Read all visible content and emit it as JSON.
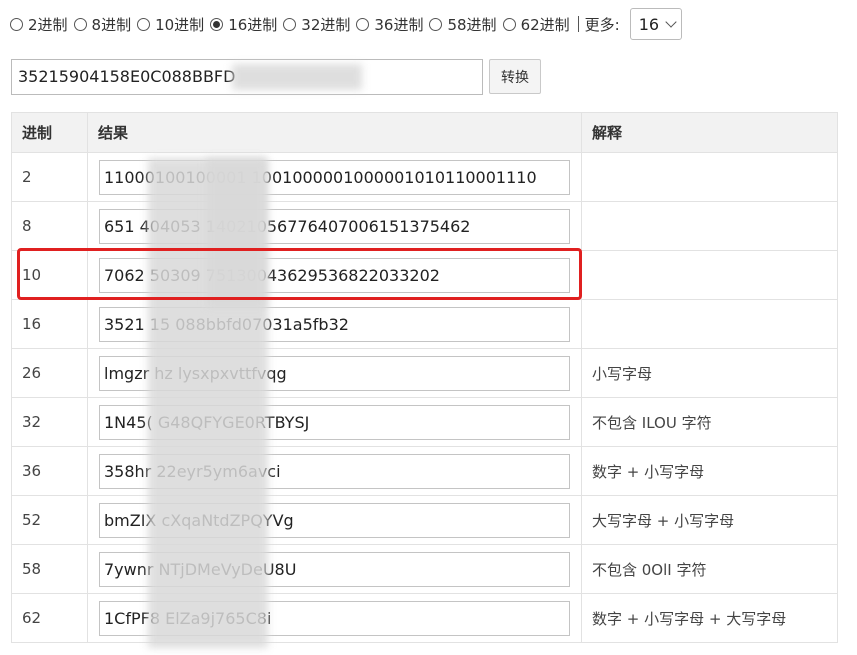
{
  "base_options": [
    {
      "label": "2进制",
      "checked": false
    },
    {
      "label": "8进制",
      "checked": false
    },
    {
      "label": "10进制",
      "checked": false
    },
    {
      "label": "16进制",
      "checked": true
    },
    {
      "label": "32进制",
      "checked": false
    },
    {
      "label": "36进制",
      "checked": false
    },
    {
      "label": "58进制",
      "checked": false
    },
    {
      "label": "62进制",
      "checked": false
    }
  ],
  "more": {
    "label": "更多:",
    "selected": "16"
  },
  "input": {
    "value": "35215904158E0C088BBFD"
  },
  "convert_label": "转换",
  "table": {
    "headers": {
      "base": "进制",
      "result": "结果",
      "note": "解释"
    },
    "rows": [
      {
        "base": "2",
        "result": "11000100100001  1001000001000001010110001110",
        "note": ""
      },
      {
        "base": "8",
        "result": "651   404053   14021056776407006151375462",
        "note": ""
      },
      {
        "base": "10",
        "result": "7062   50309    75130043629536822033202",
        "note": ""
      },
      {
        "base": "16",
        "result": "3521   15    088bbfd07031a5fb32",
        "note": ""
      },
      {
        "base": "26",
        "result": "lmgzr   hz    lysxpxvttfvqg",
        "note": "小写字母"
      },
      {
        "base": "32",
        "result": "1N45(        G48QFYGE0RTBYSJ",
        "note": "不包含 ILOU 字符"
      },
      {
        "base": "36",
        "result": "358hr         22eyr5ym6avci",
        "note": "数字 + 小写字母"
      },
      {
        "base": "52",
        "result": "bmZIX        cXqaNtdZPQYVg",
        "note": "大写字母 + 小写字母"
      },
      {
        "base": "58",
        "result": "7ywnr         NTjDMeVyDeU8U",
        "note": "不包含 0OlI 字符"
      },
      {
        "base": "62",
        "result": "1CfPF8        ElZa9j765C8i",
        "note": "数字 + 小写字母 + 大写字母"
      }
    ]
  }
}
